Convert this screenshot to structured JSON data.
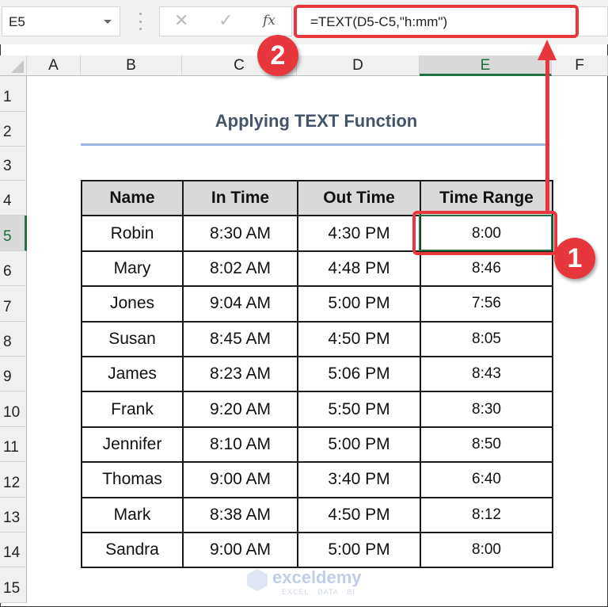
{
  "formula_bar": {
    "name_box": "E5",
    "cancel_icon": "✕",
    "enter_icon": "✓",
    "fx_label": "fx",
    "formula": "=TEXT(D5-C5,\"h:mm\")"
  },
  "columns": [
    "A",
    "B",
    "C",
    "D",
    "E",
    "F"
  ],
  "selected_column": "E",
  "rows": [
    "1",
    "2",
    "3",
    "4",
    "5",
    "6",
    "7",
    "8",
    "9",
    "10",
    "11",
    "12",
    "13",
    "14",
    "15"
  ],
  "selected_row": "5",
  "title": "Applying TEXT Function",
  "table": {
    "headers": [
      "Name",
      "In Time",
      "Out Time",
      "Time Range"
    ],
    "rows": [
      [
        "Robin",
        "8:30 AM",
        "4:30 PM",
        "8:00"
      ],
      [
        "Mary",
        "8:02 AM",
        "4:48 PM",
        "8:46"
      ],
      [
        "Jones",
        "9:04 AM",
        "5:00 PM",
        "7:56"
      ],
      [
        "Susan",
        "8:45 AM",
        "4:50 PM",
        "8:05"
      ],
      [
        "James",
        "8:23 AM",
        "5:06 PM",
        "8:43"
      ],
      [
        "Frank",
        "9:20 AM",
        "5:50 PM",
        "8:30"
      ],
      [
        "Jennifer",
        "8:10 AM",
        "5:00 PM",
        "8:50"
      ],
      [
        "Thomas",
        "9:00 AM",
        "3:40 PM",
        "6:40"
      ],
      [
        "Mark",
        "8:38 AM",
        "4:50 PM",
        "8:12"
      ],
      [
        "Sandra",
        "9:00 AM",
        "5:00 PM",
        "8:00"
      ]
    ]
  },
  "annotations": {
    "badge_1": "1",
    "badge_2": "2",
    "color": "#e8363d"
  },
  "watermark": {
    "name": "exceldemy",
    "tagline": "EXCEL · DATA · BI"
  }
}
